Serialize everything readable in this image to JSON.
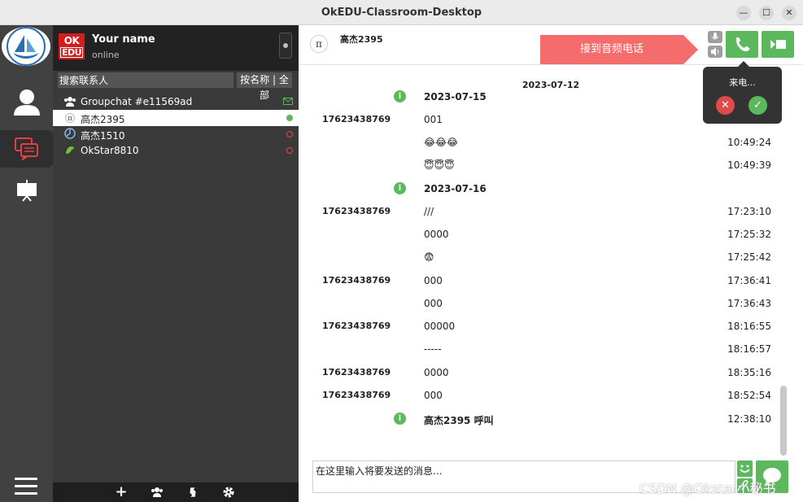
{
  "window": {
    "title": "OkEDU-Classroom-Desktop",
    "minimize": "—",
    "maximize": "☐",
    "close": "✕"
  },
  "profile": {
    "logo_top": "OK",
    "logo_bottom": "EDU",
    "name": "Your name",
    "status": "online"
  },
  "contacts_panel": {
    "search_placeholder": "搜索联系人",
    "sort_label": "按名称 | 全部",
    "items": [
      {
        "name": "Groupchat #e11569ad",
        "status_color": "#5cb85c"
      },
      {
        "name": "高杰2395",
        "status_color": "#5cb85c"
      },
      {
        "name": "高杰1510",
        "status_color": "#e04a4a"
      },
      {
        "name": "OkStar8810",
        "status_color": "#e04a4a"
      }
    ]
  },
  "chat": {
    "peer_avatar": "π",
    "peer_name": "高杰2395",
    "call_banner": "接到音频电话",
    "incoming_label": "来电...",
    "decline": "✕",
    "accept": "✓",
    "day_header": "2023-07-12",
    "messages": [
      {
        "sender": "",
        "text": "2023-07-15",
        "time": "",
        "info": true
      },
      {
        "sender": "17623438769",
        "text": "001",
        "time": "",
        "info": false
      },
      {
        "sender": "",
        "text": "😂😂😂",
        "time": "10:49:24",
        "info": false
      },
      {
        "sender": "",
        "text": "😇😇😇",
        "time": "10:49:39",
        "info": false
      },
      {
        "sender": "",
        "text": "2023-07-16",
        "time": "",
        "info": true
      },
      {
        "sender": "17623438769",
        "text": "///",
        "time": "17:23:10",
        "info": false
      },
      {
        "sender": "",
        "text": "0000",
        "time": "17:25:32",
        "info": false
      },
      {
        "sender": "",
        "text": "😨",
        "time": "17:25:42",
        "info": false
      },
      {
        "sender": "17623438769",
        "text": "000",
        "time": "17:36:41",
        "info": false
      },
      {
        "sender": "",
        "text": "000",
        "time": "17:36:43",
        "info": false
      },
      {
        "sender": "17623438769",
        "text": "00000",
        "time": "18:16:55",
        "info": false
      },
      {
        "sender": "",
        "text": "-----",
        "time": "18:16:57",
        "info": false
      },
      {
        "sender": "17623438769",
        "text": "0000",
        "time": "18:35:16",
        "info": false
      },
      {
        "sender": "17623438769",
        "text": "000",
        "time": "18:52:54",
        "info": false
      },
      {
        "sender": "",
        "text": "高杰2395 呼叫",
        "time": "12:38:10",
        "info": true
      }
    ],
    "compose_placeholder": "在这里输入将要发送的消息..."
  },
  "watermark": "CSDN @Okstar小秘书",
  "colors": {
    "accent_green": "#5cb85c",
    "banner_red": "#f56c6c",
    "rail_dark": "#414141"
  }
}
